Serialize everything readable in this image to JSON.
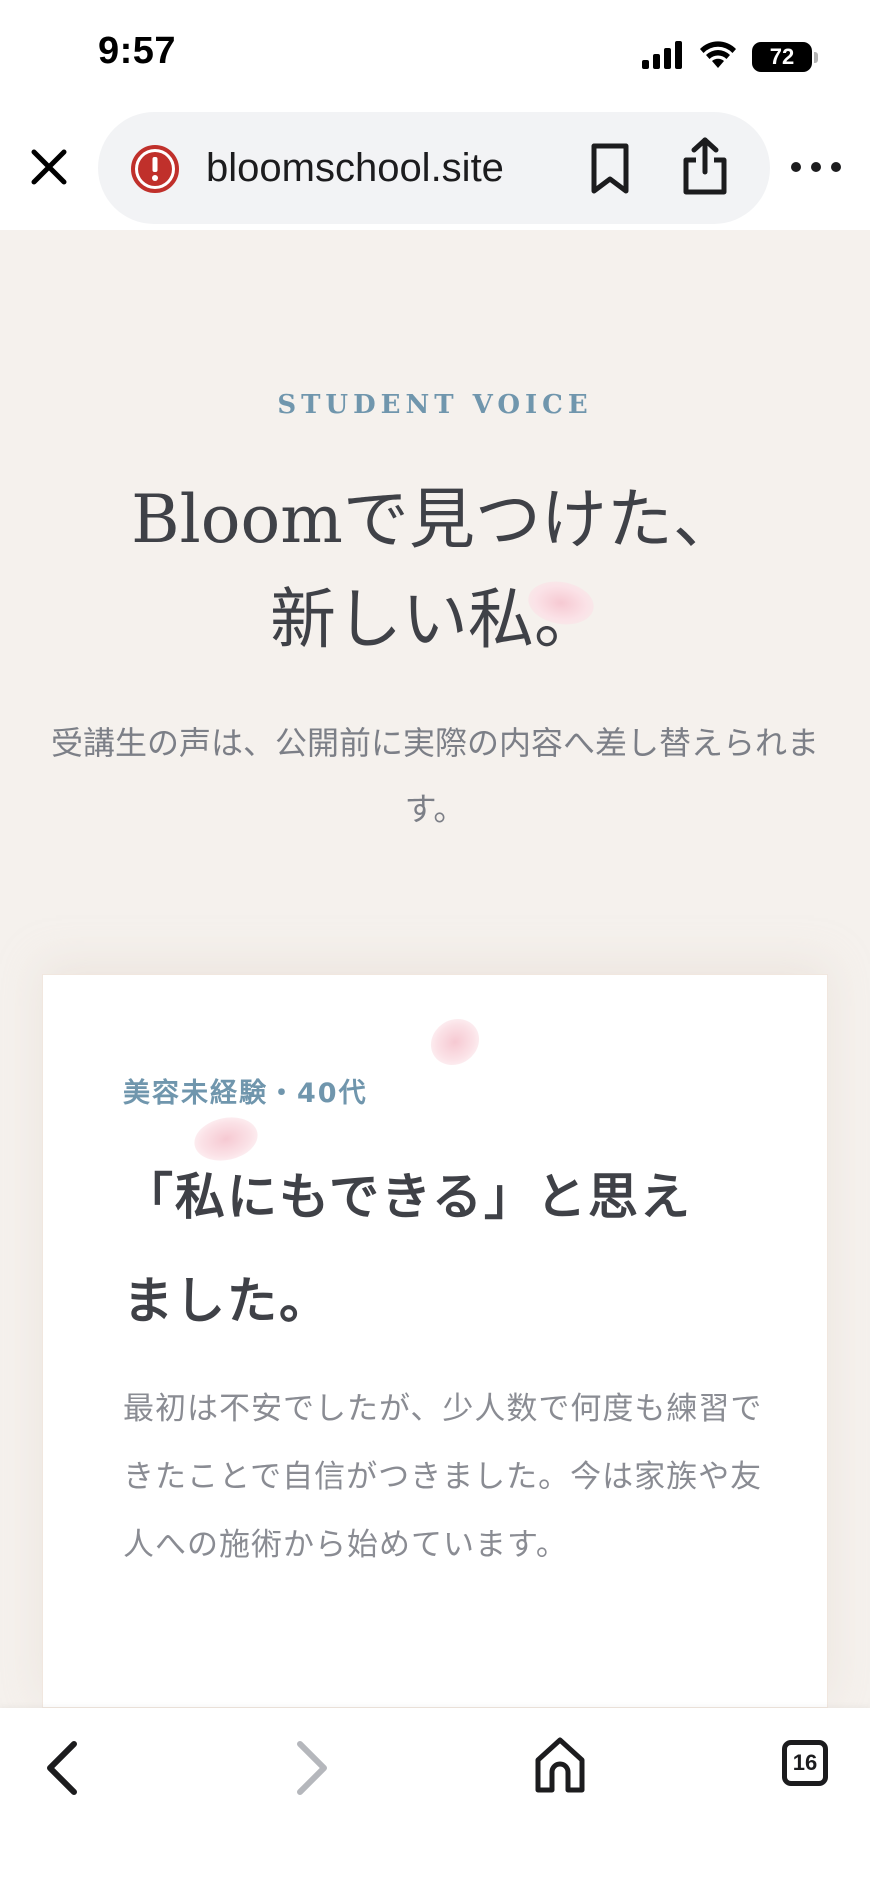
{
  "status_bar": {
    "time": "9:57",
    "battery": "72",
    "icons": [
      "cellular-signal-icon",
      "wifi-icon",
      "battery-icon"
    ]
  },
  "browser": {
    "url": "bloomschool.site",
    "icons": [
      "close-icon",
      "alert-icon",
      "bookmark-icon",
      "share-icon",
      "more-icon"
    ]
  },
  "section": {
    "eyebrow": "STUDENT VOICE",
    "title_line1": "Bloomで見つけた、",
    "title_line2": "新しい私。",
    "lead": "受講生の声は、公開前に実際の内容へ差し替えられます。"
  },
  "testimonial": {
    "label": "美容未経験・40代",
    "title_line1": "「私にもできる」と思え",
    "title_line2": "ました。",
    "body": "最初は不安でしたが、少人数で何度も練習できたことで自信がつきました。今は家族や友人への施術から始めています。"
  },
  "bottom_bar": {
    "tab_count": "16",
    "icons": [
      "back-icon",
      "forward-icon",
      "home-icon",
      "tabs-icon"
    ]
  },
  "colors": {
    "accent": "#7096ad",
    "page_bg": "#f5f1ed",
    "heading": "#3f4147",
    "muted_text": "#8a8c93",
    "alert_red": "#c0302b",
    "petal_pink": "#f6c9d2"
  }
}
